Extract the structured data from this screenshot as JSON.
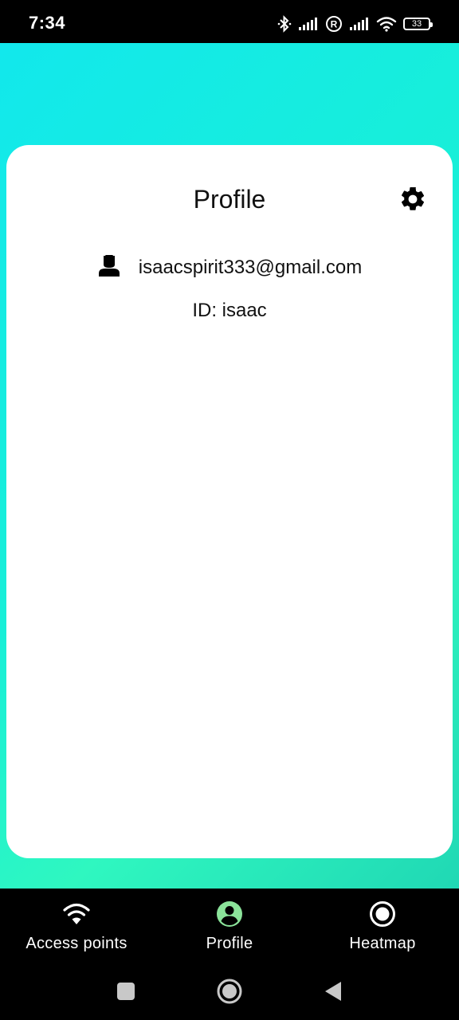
{
  "status_bar": {
    "time": "7:34",
    "battery": "33",
    "icons": [
      "bluetooth-icon",
      "signal-icon",
      "roaming-icon",
      "signal-icon",
      "wifi-icon",
      "battery-icon"
    ]
  },
  "profile": {
    "title": "Profile",
    "email": "isaacspirit333@gmail.com",
    "id_label": "ID:",
    "id_value": "isaac",
    "settings_icon": "gear-icon",
    "user_icon": "person-icon"
  },
  "nav": {
    "items": [
      {
        "label": "Access points",
        "icon": "wifi-icon"
      },
      {
        "label": "Profile",
        "icon": "account-circle-icon",
        "active": true
      },
      {
        "label": "Heatmap",
        "icon": "radio-button-icon"
      }
    ]
  },
  "colors": {
    "active_nav": "#8be39a",
    "nav_text": "#ffffff",
    "gradient_start": "#12e8ec",
    "gradient_end": "#2ff7c0",
    "card": "#ffffff"
  }
}
